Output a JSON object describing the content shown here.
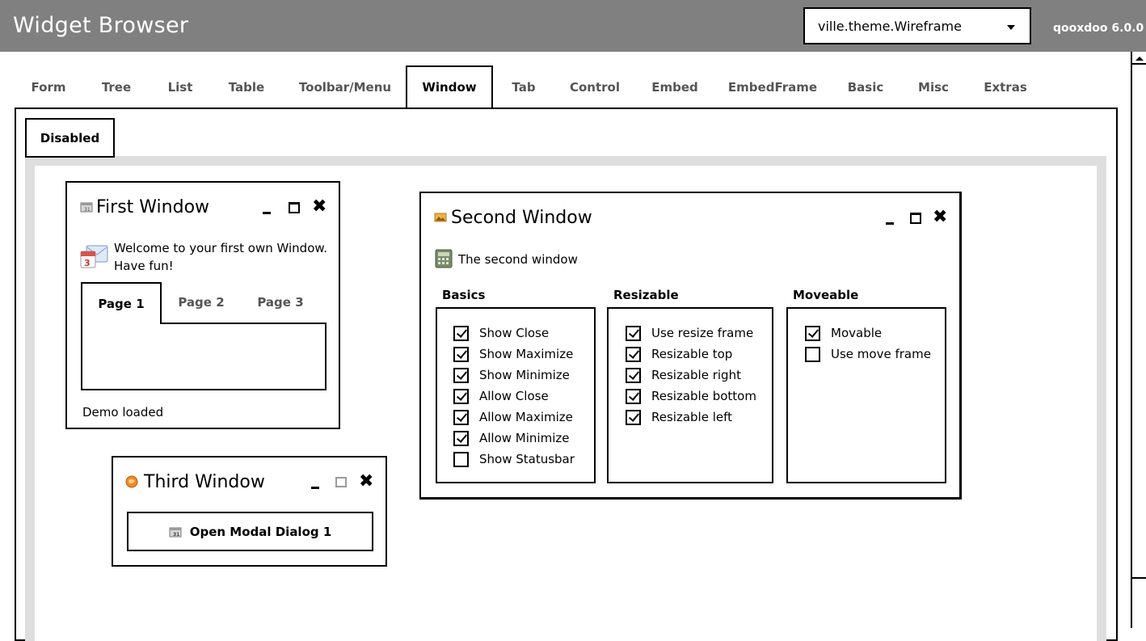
{
  "header": {
    "title": "Widget Browser",
    "theme_select_value": "ville.theme.Wireframe",
    "version": "qooxdoo 6.0.0"
  },
  "main_tabs": [
    {
      "label": "Form"
    },
    {
      "label": "Tree"
    },
    {
      "label": "List"
    },
    {
      "label": "Table"
    },
    {
      "label": "Toolbar/Menu"
    },
    {
      "label": "Window",
      "active": true
    },
    {
      "label": "Tab"
    },
    {
      "label": "Control"
    },
    {
      "label": "Embed"
    },
    {
      "label": "EmbedFrame"
    },
    {
      "label": "Basic"
    },
    {
      "label": "Misc"
    },
    {
      "label": "Extras"
    }
  ],
  "sub_tab": {
    "label": "Disabled"
  },
  "first_window": {
    "title": "First Window",
    "icon": "calendar-icon",
    "welcome_text": "Welcome to your first own Window.",
    "welcome_text_2": "Have fun!",
    "tabs": [
      {
        "label": "Page 1",
        "active": true
      },
      {
        "label": "Page 2"
      },
      {
        "label": "Page 3"
      }
    ],
    "status": "Demo loaded"
  },
  "second_window": {
    "title": "Second Window",
    "icon": "image-icon",
    "body_text": "The second window",
    "groups": {
      "basics": {
        "label": "Basics",
        "items": [
          {
            "label": "Show Close",
            "checked": true
          },
          {
            "label": "Show Maximize",
            "checked": true
          },
          {
            "label": "Show Minimize",
            "checked": true
          },
          {
            "label": "Allow Close",
            "checked": true
          },
          {
            "label": "Allow Maximize",
            "checked": true
          },
          {
            "label": "Allow Minimize",
            "checked": true
          },
          {
            "label": "Show Statusbar",
            "checked": false
          }
        ]
      },
      "resizable": {
        "label": "Resizable",
        "items": [
          {
            "label": "Use resize frame",
            "checked": true
          },
          {
            "label": "Resizable top",
            "checked": true
          },
          {
            "label": "Resizable right",
            "checked": true
          },
          {
            "label": "Resizable bottom",
            "checked": true
          },
          {
            "label": "Resizable left",
            "checked": true
          }
        ]
      },
      "moveable": {
        "label": "Moveable",
        "items": [
          {
            "label": "Movable",
            "checked": true
          },
          {
            "label": "Use move frame",
            "checked": false
          }
        ]
      }
    }
  },
  "third_window": {
    "title": "Third Window",
    "icon": "globe-icon",
    "button_label": "Open Modal Dialog 1",
    "maximize_disabled": true
  },
  "colors": {
    "header_bg": "#808080",
    "frame_gray": "#dedede"
  }
}
